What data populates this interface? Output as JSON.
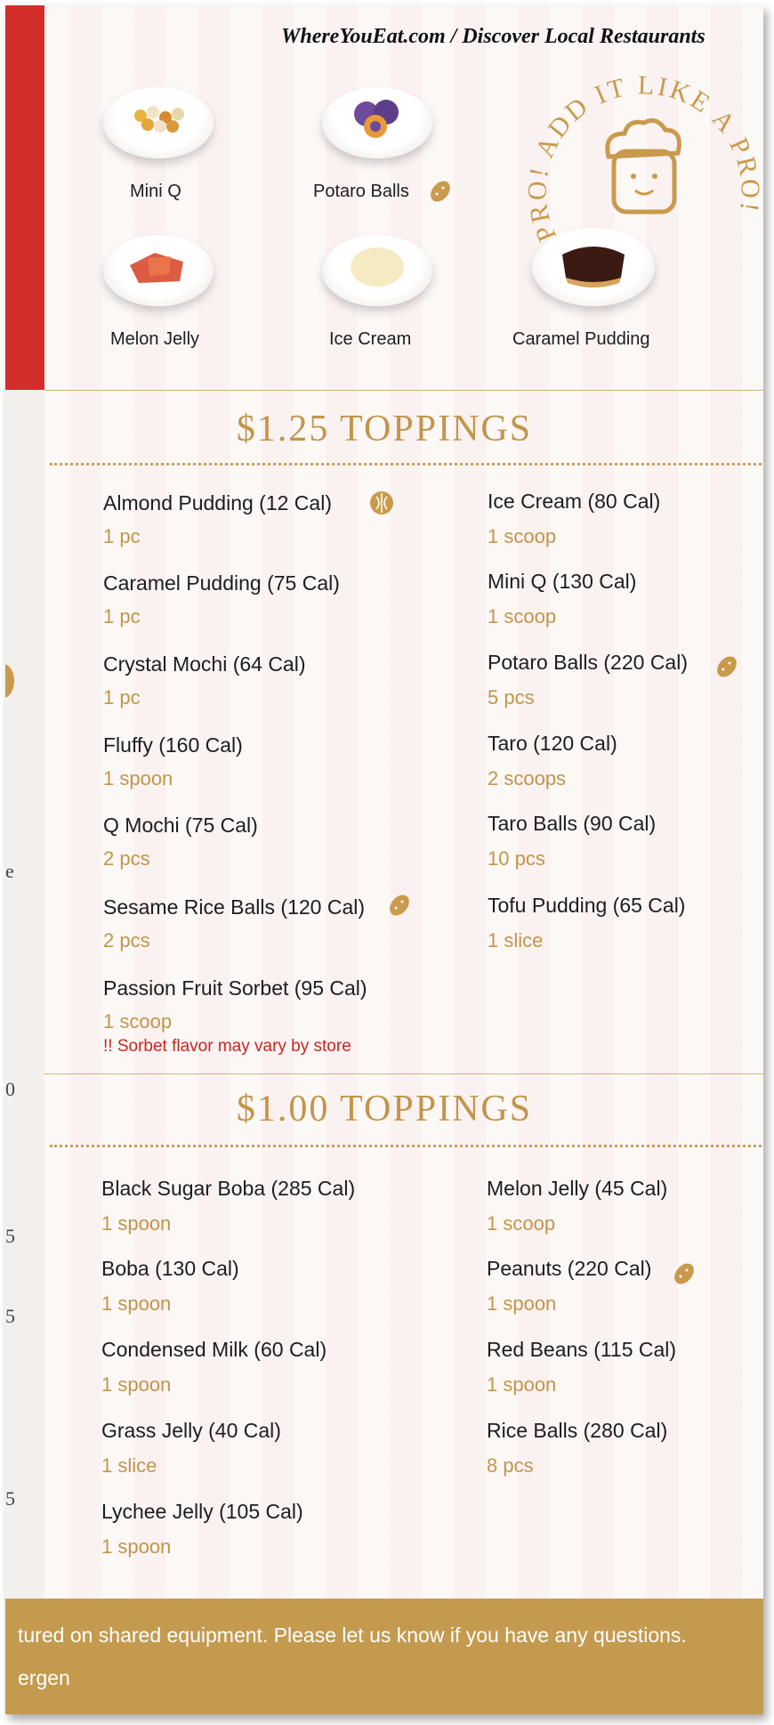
{
  "header": {
    "site": "WhereYouEat.com / Discover Local Restaurants"
  },
  "featured": {
    "items": [
      {
        "label": "Mini Q"
      },
      {
        "label": "Potaro Balls"
      },
      {
        "label": "Melon Jelly"
      },
      {
        "label": "Ice Cream"
      },
      {
        "label": "Caramel Pudding"
      }
    ],
    "stamp_text": "PRO! ADD IT LIKE A PRO! ADD IT"
  },
  "sections": [
    {
      "title": "$1.25 TOPPINGS",
      "left": [
        {
          "name": "Almond Pudding (12 Cal)",
          "qty": "1 pc",
          "icon": "almond-icon"
        },
        {
          "name": "Caramel Pudding (75 Cal)",
          "qty": "1 pc"
        },
        {
          "name": "Crystal Mochi (64 Cal)",
          "qty": "1 pc"
        },
        {
          "name": "Fluffy (160 Cal)",
          "qty": "1 spoon"
        },
        {
          "name": "Q Mochi (75 Cal)",
          "qty": "2 pcs"
        },
        {
          "name": "Sesame Rice Balls (120 Cal)",
          "qty": "2 pcs",
          "icon": "peanut-icon"
        },
        {
          "name": "Passion Fruit Sorbet (95 Cal)",
          "qty": "1 scoop"
        }
      ],
      "right": [
        {
          "name": "Ice Cream (80 Cal)",
          "qty": "1 scoop"
        },
        {
          "name": "Mini Q (130 Cal)",
          "qty": "1 scoop"
        },
        {
          "name": "Potaro Balls (220 Cal)",
          "qty": "5 pcs",
          "icon": "peanut-icon"
        },
        {
          "name": "Taro (120 Cal)",
          "qty": "2 scoops"
        },
        {
          "name": "Taro Balls (90 Cal)",
          "qty": "10 pcs"
        },
        {
          "name": "Tofu Pudding (65 Cal)",
          "qty": "1 slice"
        }
      ],
      "note": "!! Sorbet flavor may vary by store"
    },
    {
      "title": "$1.00 TOPPINGS",
      "left": [
        {
          "name": "Black Sugar Boba (285 Cal)",
          "qty": "1 spoon"
        },
        {
          "name": "Boba (130 Cal)",
          "qty": "1 spoon"
        },
        {
          "name": "Condensed Milk (60 Cal)",
          "qty": "1 spoon"
        },
        {
          "name": "Grass Jelly (40 Cal)",
          "qty": "1 slice"
        },
        {
          "name": "Lychee Jelly (105 Cal)",
          "qty": "1 spoon"
        }
      ],
      "right": [
        {
          "name": "Melon Jelly (45 Cal)",
          "qty": "1 scoop"
        },
        {
          "name": "Peanuts (220 Cal)",
          "qty": "1 spoon",
          "icon": "peanut-icon"
        },
        {
          "name": "Red Beans (115 Cal)",
          "qty": "1 spoon"
        },
        {
          "name": "Rice Balls (280 Cal)",
          "qty": "8 pcs"
        }
      ]
    }
  ],
  "footer": {
    "line1": "tured on shared equipment. Please let us know if you have any questions.",
    "line2": "ergen"
  },
  "left_edge_fragments": [
    "e",
    "0",
    "5",
    "5",
    "5"
  ],
  "colors": {
    "accent_gold": "#c2954a",
    "red_bar": "#d42e2b",
    "note_red": "#c8261f"
  }
}
